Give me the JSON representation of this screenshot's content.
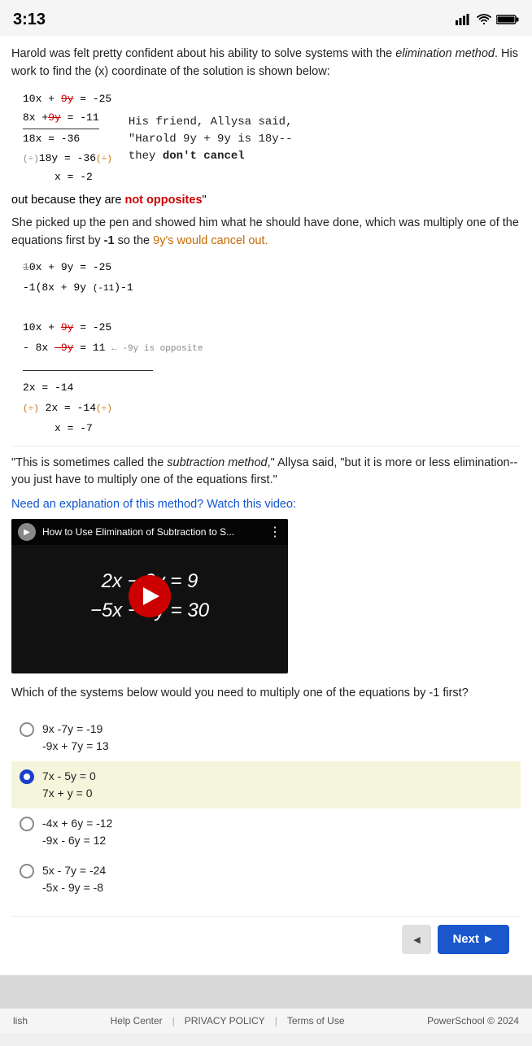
{
  "statusBar": {
    "time": "3:13",
    "icons": [
      "signal",
      "wifi",
      "battery"
    ]
  },
  "intro": {
    "text": "Harold was felt pretty confident about his ability to solve systems with the elimination method. His work  to find the (x) coordinate of the solution is shown below:"
  },
  "friendComment": "His friend, Allysa said, \"Harold 9y + 9y is 18y--they ",
  "dontCancel": "don't cancel",
  "outText": "out because they are ",
  "notOpposites": "not opposites",
  "quoteMark": "\"",
  "pickupText": "She picked up the pen and showed him what he should have done, which was multiply one of the equations first by -1 so the ",
  "cancelText": "9y's would cancel out.",
  "subtractionQuote": "\"This is sometimes called the subtraction method,\" Allysa said, \"but it is more or less elimination--you just have to multiply one of the equations first.\"",
  "watchLink": "Need an explanation of this method? Watch this video:",
  "video": {
    "title": "How to Use Elimination of Subtraction to S...",
    "math1": "2x − 3y = 9",
    "math2": "−5x − 5y = 30"
  },
  "question": "Which of the systems below would you need to multiply one of the equations by -1 first?",
  "options": [
    {
      "id": "opt1",
      "line1": "9x -7y = -19",
      "line2": "-9x + 7y = 13",
      "selected": false
    },
    {
      "id": "opt2",
      "line1": "7x - 5y = 0",
      "line2": "7x + y = 0",
      "selected": true
    },
    {
      "id": "opt3",
      "line1": "-4x + 6y = -12",
      "line2": "-9x - 6y = 12",
      "selected": false
    },
    {
      "id": "opt4",
      "line1": "5x - 7y = -24",
      "line2": "-5x - 9y = -8",
      "selected": false
    }
  ],
  "nav": {
    "prevLabel": "◄",
    "nextLabel": "Next ►"
  },
  "footer": {
    "language": "lish",
    "links": [
      "Help Center",
      "PRIVACY POLICY",
      "Terms of Use"
    ],
    "copyright": "PowerSchool © 2024"
  }
}
